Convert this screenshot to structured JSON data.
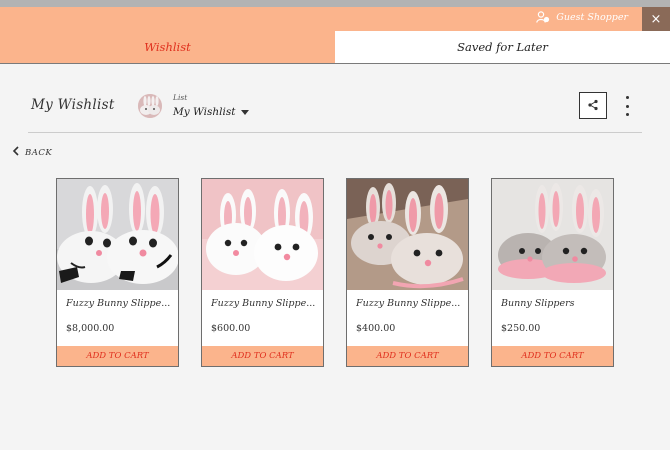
{
  "header": {
    "guest_label": "Guest Shopper",
    "user_icon": "user-icon",
    "close_icon": "close-icon",
    "close_glyph": "×"
  },
  "tabs": [
    {
      "label": "Wishlist",
      "active": true
    },
    {
      "label": "Saved for Later",
      "active": false
    }
  ],
  "page": {
    "title": "My Wishlist",
    "list_caption": "List",
    "list_value": "My Wishlist",
    "share_icon": "share-icon",
    "more_icon": "more-vertical-icon",
    "back_label": "BACK"
  },
  "products": [
    {
      "name": "Fuzzy Bunny Slippe...",
      "price": "$8,000.00",
      "button": "ADD TO CART"
    },
    {
      "name": "Fuzzy Bunny Slippe...",
      "price": "$600.00",
      "button": "ADD TO CART"
    },
    {
      "name": "Fuzzy Bunny Slippe...",
      "price": "$400.00",
      "button": "ADD TO CART"
    },
    {
      "name": "Bunny Slippers",
      "price": "$250.00",
      "button": "ADD TO CART"
    }
  ],
  "colors": {
    "accent": "#fbb48c",
    "active_text": "#e0301e",
    "close_bg": "#8a6a58"
  }
}
